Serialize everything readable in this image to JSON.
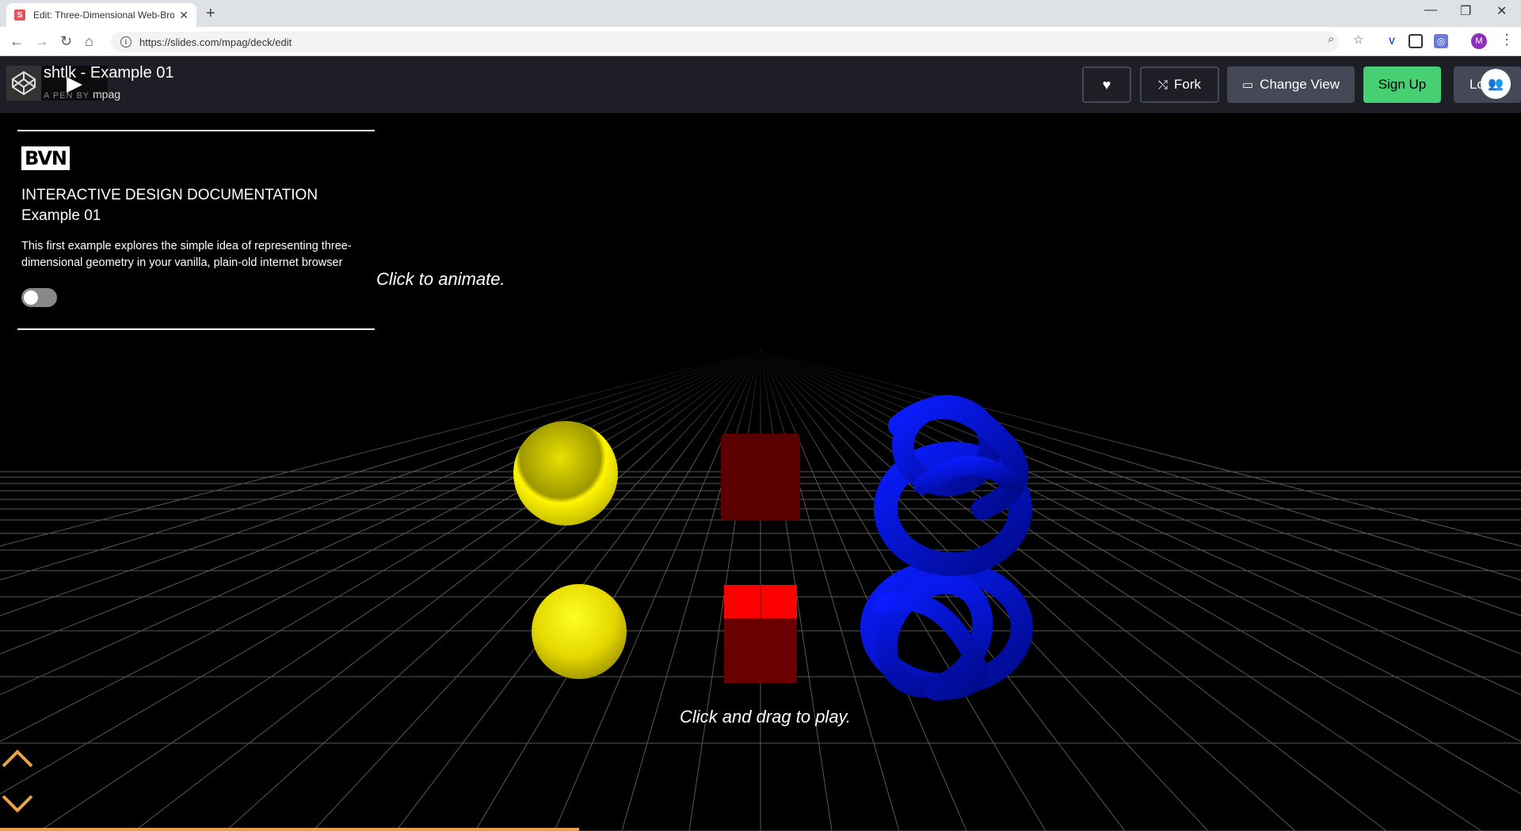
{
  "browser": {
    "tab_title": "Edit: Three-Dimensional Web-Bro",
    "tab_favicon": "S",
    "tab_close": "✕",
    "new_tab": "+",
    "url": "https://slides.com/mpag/deck/edit",
    "profile_initial": "M",
    "window_controls": [
      "—",
      "❐",
      "✕"
    ],
    "icons": [
      "back-icon",
      "forward-icon",
      "reload-icon",
      "home-icon",
      "zoom-icon",
      "star-icon",
      "extension-icon",
      "menu-icon"
    ]
  },
  "codepen": {
    "title": "shtlk - Example 01",
    "author_prefix": "A PEN BY",
    "author": "mpag",
    "buttons": {
      "fork": "Fork",
      "change_view": "Change View",
      "sign_up": "Sign Up",
      "login": "Lo"
    },
    "colors": {
      "header_bg": "#1e1f26",
      "signup_green": "#47cf73",
      "button_grey": "#444857"
    }
  },
  "panel": {
    "logo": "BVN",
    "heading_line1": "INTERACTIVE DESIGN DOCUMENTATION",
    "heading_line2": "Example 01",
    "description": "This first example explores the simple idea of representing three-dimensional geometry in your vanilla, plain-old internet browser",
    "toggle_on": false
  },
  "scene": {
    "hint_animate": "Click to animate.",
    "hint_play": "Click and drag to play.",
    "objects": [
      "yellow-sphere",
      "red-cube",
      "blue-torus-knot"
    ],
    "colors": {
      "sphere": "#f0e000",
      "cube": "#ff0000",
      "knot": "#0018ff",
      "progress": "#e8a24a"
    }
  }
}
